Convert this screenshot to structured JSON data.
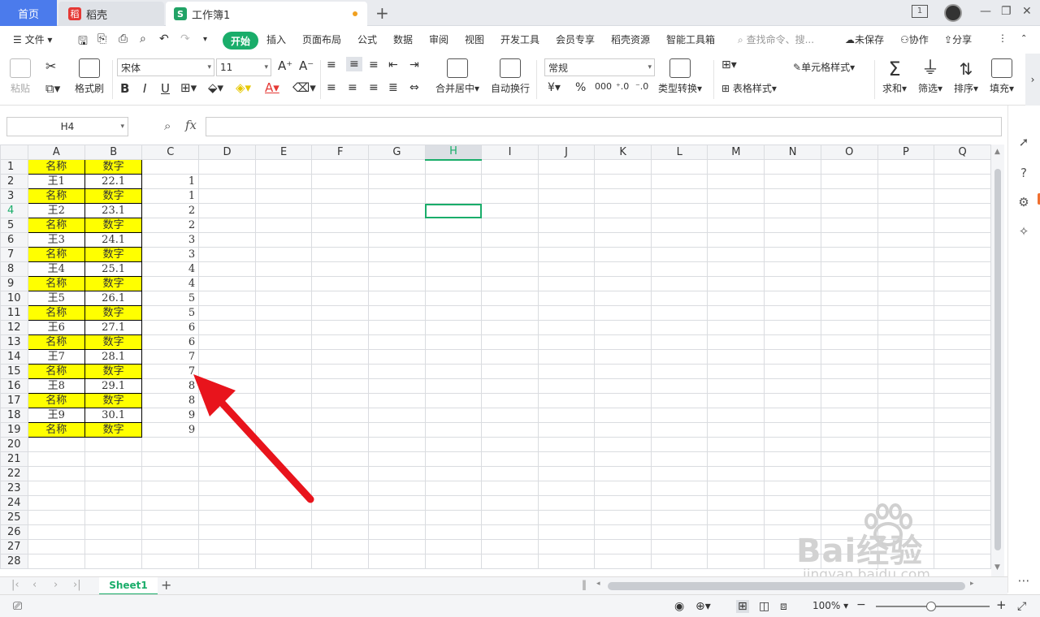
{
  "tabs": {
    "home": "首页",
    "docer": "稻壳",
    "workbook": "工作簿1"
  },
  "menu": [
    "文件",
    "开始",
    "插入",
    "页面布局",
    "公式",
    "数据",
    "审阅",
    "视图",
    "开发工具",
    "会员专享",
    "稻壳资源",
    "智能工具箱"
  ],
  "search": "查找命令、搜...",
  "unsaved": "未保存",
  "collab": "协作",
  "share": "分享",
  "ribbon": {
    "paste": "粘贴",
    "format_painter": "格式刷",
    "font": "宋体",
    "font_size": "11",
    "merge": "合并居中",
    "wrap": "自动换行",
    "number_format": "常规",
    "type_convert": "类型转换",
    "cell_style": "单元格样式",
    "table_style": "表格样式",
    "sum": "求和",
    "filter": "筛选",
    "sort": "排序",
    "fill": "填充"
  },
  "name_box": "H4",
  "fx": "fx",
  "columns": [
    "A",
    "B",
    "C",
    "D",
    "E",
    "F",
    "G",
    "H",
    "I",
    "J",
    "K",
    "L",
    "M",
    "N",
    "O",
    "P",
    "Q"
  ],
  "rows": [
    {
      "n": "1",
      "a": "名称",
      "b": "数字",
      "c": "",
      "hl": true
    },
    {
      "n": "2",
      "a": "王1",
      "b": "22.1",
      "c": "1",
      "hl": false
    },
    {
      "n": "3",
      "a": "名称",
      "b": "数字",
      "c": "1",
      "hl": true
    },
    {
      "n": "4",
      "a": "王2",
      "b": "23.1",
      "c": "2",
      "hl": false
    },
    {
      "n": "5",
      "a": "名称",
      "b": "数字",
      "c": "2",
      "hl": true
    },
    {
      "n": "6",
      "a": "王3",
      "b": "24.1",
      "c": "3",
      "hl": false
    },
    {
      "n": "7",
      "a": "名称",
      "b": "数字",
      "c": "3",
      "hl": true
    },
    {
      "n": "8",
      "a": "王4",
      "b": "25.1",
      "c": "4",
      "hl": false
    },
    {
      "n": "9",
      "a": "名称",
      "b": "数字",
      "c": "4",
      "hl": true
    },
    {
      "n": "10",
      "a": "王5",
      "b": "26.1",
      "c": "5",
      "hl": false
    },
    {
      "n": "11",
      "a": "名称",
      "b": "数字",
      "c": "5",
      "hl": true
    },
    {
      "n": "12",
      "a": "王6",
      "b": "27.1",
      "c": "6",
      "hl": false
    },
    {
      "n": "13",
      "a": "名称",
      "b": "数字",
      "c": "6",
      "hl": true
    },
    {
      "n": "14",
      "a": "王7",
      "b": "28.1",
      "c": "7",
      "hl": false
    },
    {
      "n": "15",
      "a": "名称",
      "b": "数字",
      "c": "7",
      "hl": true
    },
    {
      "n": "16",
      "a": "王8",
      "b": "29.1",
      "c": "8",
      "hl": false
    },
    {
      "n": "17",
      "a": "名称",
      "b": "数字",
      "c": "8",
      "hl": true
    },
    {
      "n": "18",
      "a": "王9",
      "b": "30.1",
      "c": "9",
      "hl": false
    },
    {
      "n": "19",
      "a": "名称",
      "b": "数字",
      "c": "9",
      "hl": true
    },
    {
      "n": "20",
      "a": "",
      "b": "",
      "c": "",
      "hl": false
    },
    {
      "n": "21",
      "a": "",
      "b": "",
      "c": "",
      "hl": false
    },
    {
      "n": "22",
      "a": "",
      "b": "",
      "c": "",
      "hl": false
    },
    {
      "n": "23",
      "a": "",
      "b": "",
      "c": "",
      "hl": false
    },
    {
      "n": "24",
      "a": "",
      "b": "",
      "c": "",
      "hl": false
    },
    {
      "n": "25",
      "a": "",
      "b": "",
      "c": "",
      "hl": false
    },
    {
      "n": "26",
      "a": "",
      "b": "",
      "c": "",
      "hl": false
    },
    {
      "n": "27",
      "a": "",
      "b": "",
      "c": "",
      "hl": false
    },
    {
      "n": "28",
      "a": "",
      "b": "",
      "c": "",
      "hl": false
    }
  ],
  "active_cell": {
    "col": "H",
    "row": "4"
  },
  "sheet": "Sheet1",
  "zoom": "100%",
  "watermark": {
    "text": "Bai经验",
    "url": "jingyan.baidu.com"
  },
  "colors": {
    "accent": "#1aad6a",
    "highlight": "#ffff00",
    "arrow": "#e8141c"
  }
}
